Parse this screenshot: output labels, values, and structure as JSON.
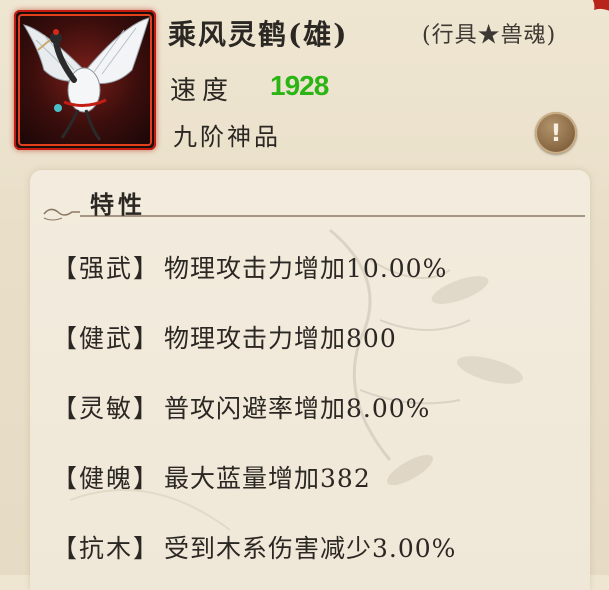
{
  "pet": {
    "name": "乘风灵鹤(雄)",
    "category": "(行具★兽魂)",
    "speed_label": "速度",
    "speed_value": "1928",
    "grade": "九阶神品"
  },
  "info_button": {
    "icon": "exclamation-icon",
    "glyph": "!"
  },
  "traits_section": {
    "title": "特性",
    "items": [
      {
        "name": "【强武】",
        "desc": "物理攻击力增加10.00%"
      },
      {
        "name": "【健武】",
        "desc": "物理攻击力增加800"
      },
      {
        "name": "【灵敏】",
        "desc": "普攻闪避率增加8.00%"
      },
      {
        "name": "【健魄】",
        "desc": "最大蓝量增加382"
      },
      {
        "name": "【抗木】",
        "desc": "受到木系伤害减少3.00%"
      }
    ]
  },
  "colors": {
    "speed_value": "#2ab515",
    "portrait_border": "#c21c10",
    "background": "#efe6d2",
    "info_button": "#8a6a45"
  }
}
